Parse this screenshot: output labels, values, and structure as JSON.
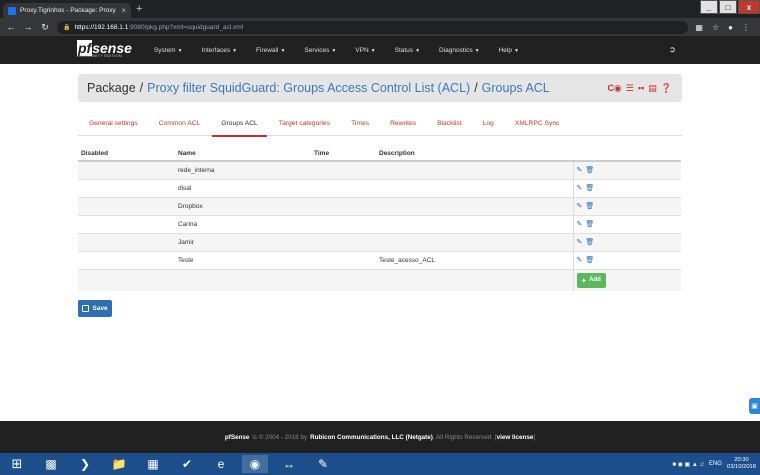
{
  "browser": {
    "tab_title": "Proxy.Tigrinhos - Package: Proxy",
    "tab_close": "×",
    "new_tab": "+",
    "url_host": "https://192.168.1.1",
    "url_rest": ":9080/pkg.php?xml=squidguard_acl.xml",
    "minimize": "_",
    "maximize": "□",
    "close": "x"
  },
  "nav": {
    "logo_text": "sense",
    "logo_pf": "pf",
    "logo_sub": "COMMUNITY EDITION",
    "menu": [
      {
        "label": "System"
      },
      {
        "label": "Interfaces"
      },
      {
        "label": "Firewall"
      },
      {
        "label": "Services"
      },
      {
        "label": "VPN"
      },
      {
        "label": "Status"
      },
      {
        "label": "Diagnostics"
      },
      {
        "label": "Help"
      }
    ]
  },
  "header": {
    "root": "Package",
    "sep": "/",
    "crumb1": "Proxy filter SquidGuard: Groups Access Control List (ACL)",
    "crumb2": "Groups ACL"
  },
  "tabs": [
    {
      "label": "General settings"
    },
    {
      "label": "Common ACL"
    },
    {
      "label": "Groups ACL"
    },
    {
      "label": "Target categories"
    },
    {
      "label": "Times"
    },
    {
      "label": "Rewrites"
    },
    {
      "label": "Blacklist"
    },
    {
      "label": "Log"
    },
    {
      "label": "XMLRPC Sync"
    }
  ],
  "table": {
    "headers": {
      "disabled": "Disabled",
      "name": "Name",
      "time": "Time",
      "description": "Description"
    },
    "rows": [
      {
        "disabled": "",
        "name": "rede_interna",
        "time": "",
        "description": ""
      },
      {
        "disabled": "",
        "name": "disal",
        "time": "",
        "description": ""
      },
      {
        "disabled": "",
        "name": "Dropbox",
        "time": "",
        "description": ""
      },
      {
        "disabled": "",
        "name": "Carina",
        "time": "",
        "description": ""
      },
      {
        "disabled": "",
        "name": "Jamir",
        "time": "",
        "description": ""
      },
      {
        "disabled": "",
        "name": "Teste",
        "time": "",
        "description": "Teste_acesso_ACL"
      }
    ],
    "add_label": "Add"
  },
  "save_label": "Save",
  "footer": {
    "brand": "pfSense",
    "copy": "is © 2004 - 2018 by",
    "company": "Rubicon Communications, LLC (Netgate)",
    "rights": ". All Rights Reserved. [",
    "license": "view license",
    "end": "]"
  },
  "taskbar": {
    "lang": "ENG",
    "time": "20:30",
    "date": "03/10/2018"
  },
  "colors": {
    "accent_red": "#c9302c",
    "link_blue": "#3a7ab8",
    "add_green": "#5cb85c",
    "nav_dark": "#212121"
  }
}
